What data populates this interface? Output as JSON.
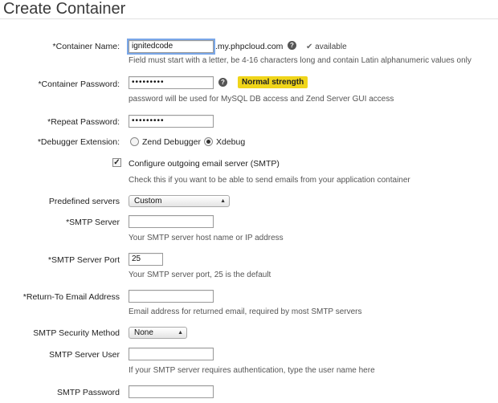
{
  "page": {
    "title": "Create Container"
  },
  "container_name": {
    "label": "*Container Name:",
    "value": "ignitedcode",
    "suffix": ".my.phpcloud.com",
    "help": "?",
    "availability": "available",
    "hint": "Field must start with a letter, be 4-16 characters long and contain Latin alphanumeric values only"
  },
  "container_password": {
    "label": "*Container Password:",
    "value": "•••••••••",
    "help": "?",
    "strength": "Normal strength",
    "hint": "password will be used for MySQL DB access and Zend Server GUI access"
  },
  "repeat_password": {
    "label": "*Repeat Password:",
    "value": "•••••••••"
  },
  "debugger": {
    "label": "*Debugger Extension:",
    "options": [
      "Zend Debugger",
      "Xdebug"
    ],
    "selected": "Xdebug"
  },
  "smtp_config": {
    "label": "Configure outgoing email server (SMTP)",
    "checked": true,
    "hint": "Check this if you want to be able to send emails from your application container"
  },
  "predefined_servers": {
    "label": "Predefined servers",
    "value": "Custom"
  },
  "smtp_server": {
    "label": "*SMTP Server",
    "value": "",
    "hint": "Your SMTP server host name or IP address"
  },
  "smtp_port": {
    "label": "*SMTP Server Port",
    "value": "25",
    "hint": "Your SMTP server port, 25 is the default"
  },
  "return_email": {
    "label": "*Return-To Email Address",
    "value": "",
    "hint": "Email address for returned email, required by most SMTP servers"
  },
  "security_method": {
    "label": "SMTP Security Method",
    "value": "None"
  },
  "smtp_user": {
    "label": "SMTP Server User",
    "value": "",
    "hint": "If your SMTP server requires authentication, type the user name here"
  },
  "smtp_password": {
    "label": "SMTP Password",
    "value": ""
  }
}
